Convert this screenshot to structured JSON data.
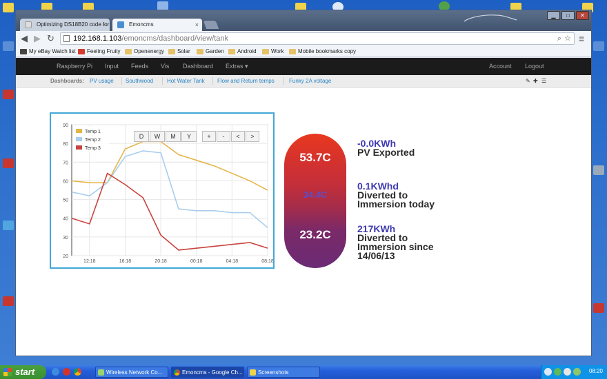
{
  "browser": {
    "tabs": [
      {
        "title": "Optimizing DS18B20 code for",
        "close": "×"
      },
      {
        "title": "Emoncms",
        "close": "×"
      }
    ],
    "window_buttons": {
      "minimize": "▁",
      "maximize": "□",
      "close": "✕"
    },
    "nav": {
      "back": "◀",
      "forward": "▶",
      "reload": "↻"
    },
    "address": {
      "host": "192.168.1.103",
      "path": "/emoncms/dashboard/view/tank"
    },
    "address_icons": {
      "search": "⌕",
      "star": "☆",
      "menu": "≡"
    },
    "bookmarks": [
      "My eBay Watch list",
      "Feeling Fruity",
      "Openenergy",
      "Solar",
      "Garden",
      "Android",
      "Work",
      "Mobile bookmarks copy"
    ]
  },
  "topnav": {
    "items": [
      "Raspberry Pi",
      "Input",
      "Feeds",
      "Vis",
      "Dashboard",
      "Extras ▾"
    ],
    "account": "Account",
    "logout": "Logout"
  },
  "subnav": {
    "label": "Dashboards:",
    "items": [
      "PV usage",
      "Southwood",
      "Hot Water Tank",
      "Flow and Return temps",
      "Funky 2A voltage"
    ],
    "controls": [
      "✎",
      "✚",
      "☰"
    ]
  },
  "range_buttons": [
    "D",
    "W",
    "M",
    "Y",
    "+",
    "-",
    "<",
    ">"
  ],
  "chart_data": {
    "type": "line",
    "x": [
      "10:18",
      "12:18",
      "14:18",
      "16:18",
      "18:18",
      "20:18",
      "22:18",
      "00:18",
      "02:18",
      "04:18",
      "06:18",
      "08:18"
    ],
    "xticks": [
      "12:18",
      "16:18",
      "20:18",
      "00:18",
      "04:18",
      "08:18"
    ],
    "yticks": [
      20,
      30,
      40,
      50,
      60,
      70,
      80,
      90
    ],
    "ylim": [
      20,
      90
    ],
    "series": [
      {
        "name": "Temp 1",
        "color": "#e5b64a",
        "values": [
          60,
          59,
          59,
          77,
          81,
          81,
          74,
          71,
          68,
          64,
          60,
          55
        ]
      },
      {
        "name": "Temp 2",
        "color": "#a9cdee",
        "values": [
          54,
          52,
          59,
          73,
          76,
          75,
          45,
          44,
          44,
          43,
          43,
          35
        ]
      },
      {
        "name": "Temp 3",
        "color": "#c9443f",
        "values": [
          40,
          37,
          64,
          58,
          51,
          31,
          23,
          24,
          25,
          26,
          27,
          24
        ]
      }
    ]
  },
  "tank": {
    "top": "53.7C",
    "middle": "34.4C",
    "bottom": "23.2C"
  },
  "stats": [
    {
      "value": "-0.0KWh",
      "label": "PV Exported"
    },
    {
      "value": "0.1KWhd",
      "label": "Diverted to Immersion today"
    },
    {
      "value": "217KWh",
      "label": "Diverted to Immersion since 14/06/13"
    }
  ],
  "taskbar": {
    "start": "start",
    "buttons": [
      "Wireless Network Co...",
      "Emoncms - Google Ch...",
      "Screenshots"
    ],
    "clock": "08:20"
  }
}
